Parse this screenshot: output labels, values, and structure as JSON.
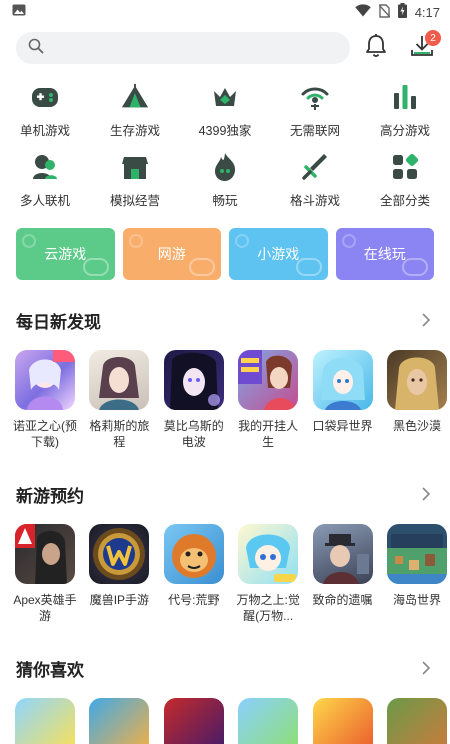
{
  "status_bar": {
    "time": "4:17"
  },
  "search": {
    "placeholder": ""
  },
  "header": {
    "download_badge": "2"
  },
  "categories": [
    {
      "label": "单机游戏",
      "icon": "gamepad-icon"
    },
    {
      "label": "生存游戏",
      "icon": "tent-icon"
    },
    {
      "label": "4399独家",
      "icon": "crown-icon"
    },
    {
      "label": "无需联网",
      "icon": "no-wifi-icon"
    },
    {
      "label": "高分游戏",
      "icon": "bar-chart-icon"
    },
    {
      "label": "多人联机",
      "icon": "multiplayer-icon"
    },
    {
      "label": "模拟经营",
      "icon": "shop-icon"
    },
    {
      "label": "畅玩",
      "icon": "flame-icon"
    },
    {
      "label": "格斗游戏",
      "icon": "sword-icon"
    },
    {
      "label": "全部分类",
      "icon": "grid-icon"
    }
  ],
  "quick_buttons": [
    {
      "label": "云游戏",
      "color": "#5ccb8a"
    },
    {
      "label": "网游",
      "color": "#f9ad6b"
    },
    {
      "label": "小游戏",
      "color": "#5ec3f0"
    },
    {
      "label": "在线玩",
      "color": "#8a85f2"
    }
  ],
  "sections": [
    {
      "title": "每日新发现",
      "games": [
        "诺亚之心(预下载)",
        "格莉斯的旅程",
        "莫比乌斯的电波",
        "我的开挂人生",
        "口袋异世界",
        "黑色沙漠"
      ]
    },
    {
      "title": "新游预约",
      "games": [
        "Apex英雄手游",
        "魔兽IP手游",
        "代号:荒野",
        "万物之上:觉醒(万物...",
        "致命的遗嘱",
        "海岛世界"
      ]
    },
    {
      "title": "猜你喜欢",
      "games": [
        "",
        "",
        "",
        "",
        "",
        ""
      ]
    }
  ],
  "colors": {
    "icon_green": "#2fb36b",
    "icon_dark": "#3a4a45"
  }
}
